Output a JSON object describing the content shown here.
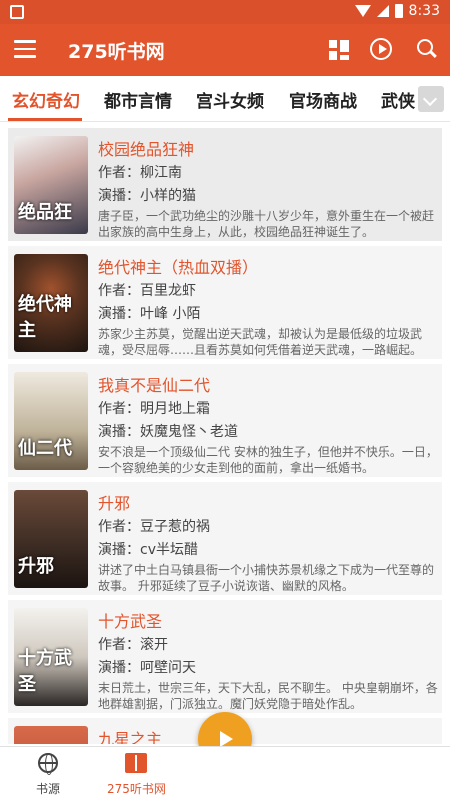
{
  "status_bar": {
    "time": "8:33"
  },
  "app_bar": {
    "title": "275听书网"
  },
  "tabs": [
    {
      "label": "玄幻奇幻",
      "active": true
    },
    {
      "label": "都市言情"
    },
    {
      "label": "宫斗女频"
    },
    {
      "label": "官场商战"
    },
    {
      "label": "武侠"
    }
  ],
  "books": [
    {
      "title": "校园绝品狂神",
      "author": "作者：柳江南",
      "narrator": "演播：小样的猫",
      "desc": "唐子臣，一个武功绝尘的沙雕十八岁少年，意外重生在一个被赶出家族的高中生身上，从此，校园绝品狂神诞生了。",
      "cover_text": "绝品狂",
      "cover_color": "#3a3a4a"
    },
    {
      "title": "绝代神主（热血双播）",
      "author": "作者：百里龙虾",
      "narrator": "演播：叶峰 小陌",
      "desc": "苏家少主苏莫，觉醒出逆天武魂，却被认为是最低级的垃圾武魂，受尽屈辱……且看苏莫如何凭借着逆天武魂，一路崛起。",
      "cover_text": "绝代神主",
      "cover_color": "#2b2118"
    },
    {
      "title": "我真不是仙二代",
      "author": "作者：明月地上霜",
      "narrator": "演播：妖魔鬼怪丶老道",
      "desc": "安不浪是一个顶级仙二代 安林的独生子，但他并不快乐。一日，一个容貌绝美的少女走到他的面前，拿出一纸婚书。",
      "cover_text": "仙二代",
      "cover_color": "#d8d0c0"
    },
    {
      "title": "升邪",
      "author": "作者：豆子惹的祸",
      "narrator": "演播：cv半坛醋",
      "desc": "讲述了中土白马镇县衙一个小捕快苏景机缘之下成为一代至尊的故事。 升邪延续了豆子小说诙谐、幽默的风格。",
      "cover_text": "升邪",
      "cover_color": "#3a2a22"
    },
    {
      "title": "十方武圣",
      "author": "作者：滚开",
      "narrator": "演播：呵壁问天",
      "desc": "末日荒土，世宗三年，天下大乱，民不聊生。 中央皇朝崩坏，各地群雄割据，门派独立。魔门妖党隐于暗处作乱。",
      "cover_text": "十方武圣",
      "cover_color": "#e8e4de"
    },
    {
      "title": "九星之主",
      "author": "",
      "narrator": "",
      "desc": "",
      "cover_text": "",
      "cover_color": "#c24a3a"
    }
  ],
  "bottom_nav": [
    {
      "label": "书源"
    },
    {
      "label": "275听书网",
      "active": true
    }
  ],
  "colors": {
    "accent": "#e2542c",
    "fab": "#f0a020"
  }
}
